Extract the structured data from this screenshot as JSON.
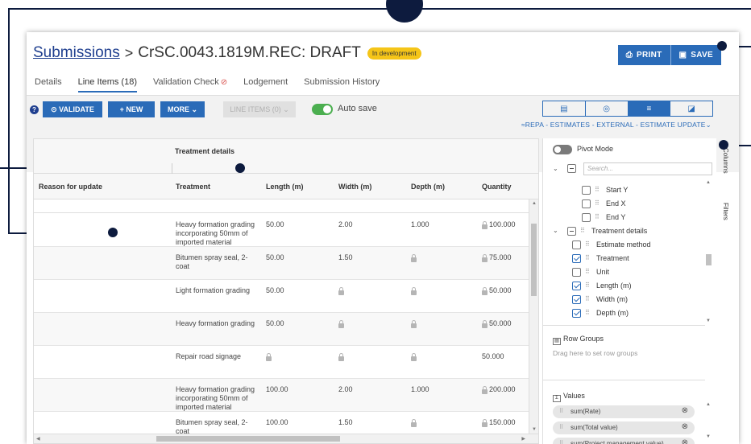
{
  "breadcrumb": {
    "root": "Submissions",
    "separator": ">",
    "title": "CrSC.0043.1819M.REC: DRAFT",
    "status": "In development"
  },
  "actions": {
    "print": "PRINT",
    "save": "SAVE"
  },
  "tabs": [
    {
      "label": "Details"
    },
    {
      "label": "Line Items (18)"
    },
    {
      "label": "Validation Check"
    },
    {
      "label": "Lodgement"
    },
    {
      "label": "Submission History"
    }
  ],
  "toolbar": {
    "help": "?",
    "validate": "⊙ VALIDATE",
    "new": "+ NEW",
    "more": "MORE ⌄",
    "line_items": "LINE ITEMS (0) ⌄",
    "autosave": "Auto save",
    "estimate_link": "≈REPA - ESTIMATES - EXTERNAL - ESTIMATE UPDATE⌄"
  },
  "grid": {
    "group_header": "Treatment details",
    "columns": [
      "Reason for update",
      "Treatment",
      "Length (m)",
      "Width (m)",
      "Depth (m)",
      "Quantity"
    ],
    "rows": [
      {
        "reason": "",
        "treatment": "Heavy formation grading incorporating 50mm of imported material",
        "length": "50.00",
        "width": "2.00",
        "depth": "1.000",
        "quantity": "100.000"
      },
      {
        "reason": "",
        "treatment": "Bitumen spray seal, 2-coat",
        "length": "50.00",
        "width": "1.50",
        "depth": "",
        "quantity": "75.000"
      },
      {
        "reason": "",
        "treatment": "Light formation grading",
        "length": "50.00",
        "width": "",
        "depth": "",
        "quantity": "50.000"
      },
      {
        "reason": "",
        "treatment": "Heavy formation grading",
        "length": "50.00",
        "width": "",
        "depth": "",
        "quantity": "50.000"
      },
      {
        "reason": "",
        "treatment": "Repair road signage",
        "length": "",
        "width": "",
        "depth": "",
        "quantity": "50.000"
      },
      {
        "reason": "",
        "treatment": "Heavy formation grading incorporating 50mm of imported material",
        "length": "100.00",
        "width": "2.00",
        "depth": "1.000",
        "quantity": "200.000"
      },
      {
        "reason": "",
        "treatment": "Bitumen spray seal, 2-coat",
        "length": "100.00",
        "width": "1.50",
        "depth": "",
        "quantity": "150.000"
      }
    ]
  },
  "side_panel": {
    "pivot_mode": "Pivot Mode",
    "search_placeholder": "Search...",
    "columns": [
      {
        "label": "Start Y",
        "checked": false
      },
      {
        "label": "End X",
        "checked": false
      },
      {
        "label": "End Y",
        "checked": false
      }
    ],
    "group_label": "Treatment details",
    "group_columns": [
      {
        "label": "Estimate method",
        "checked": false
      },
      {
        "label": "Treatment",
        "checked": true
      },
      {
        "label": "Unit",
        "checked": false
      },
      {
        "label": "Length (m)",
        "checked": true
      },
      {
        "label": "Width (m)",
        "checked": true
      },
      {
        "label": "Depth (m)",
        "checked": true
      }
    ],
    "row_groups": "Row Groups",
    "row_groups_hint": "Drag here to set row groups",
    "values": "Values",
    "value_items": [
      "sum(Rate)",
      "sum(Total value)",
      "sum(Project management value)"
    ]
  },
  "vertical_tabs": {
    "columns": "Columns",
    "filters": "Filters"
  }
}
